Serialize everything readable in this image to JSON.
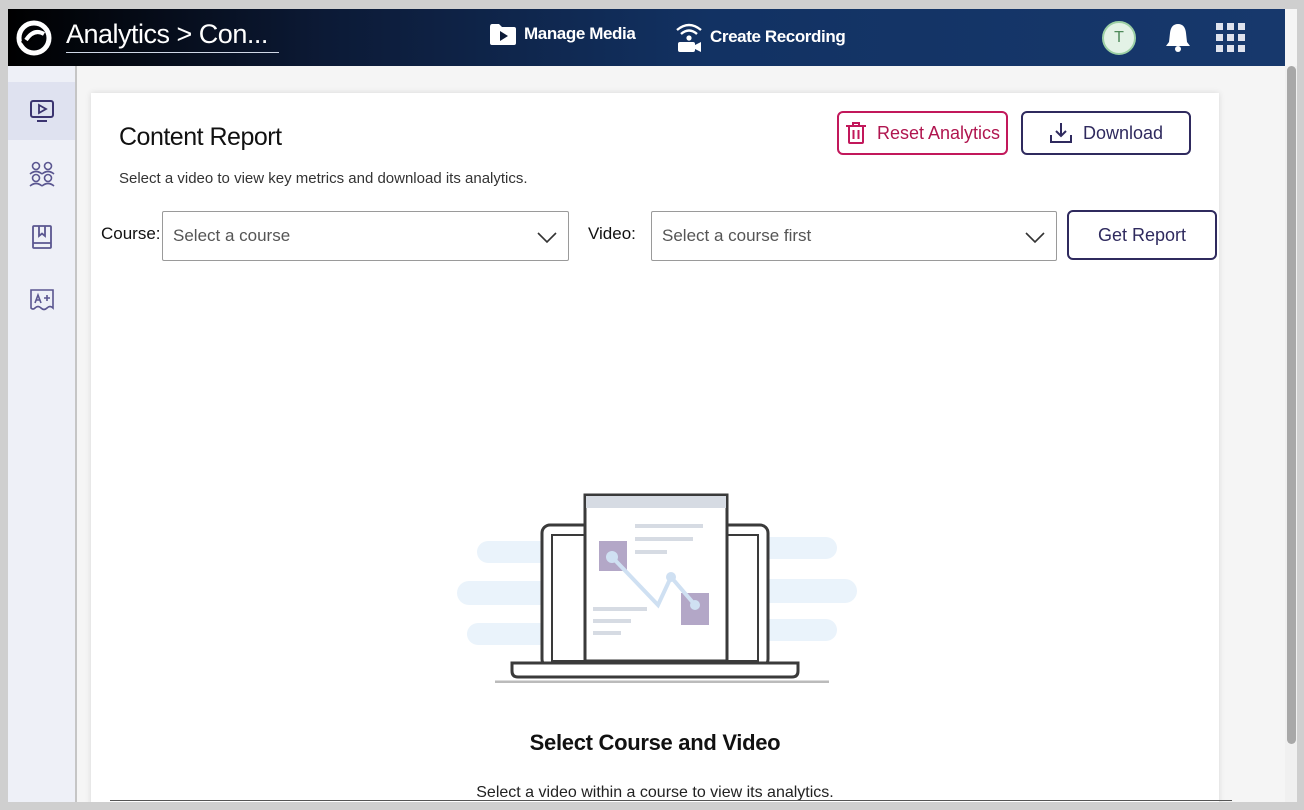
{
  "topbar": {
    "breadcrumb": "Analytics > Con...",
    "manage_media": "Manage Media",
    "create_recording": "Create Recording",
    "avatar_initial": "T"
  },
  "sidebar": {
    "items": [
      {
        "icon": "video-icon",
        "active": true
      },
      {
        "icon": "users-icon",
        "active": false
      },
      {
        "icon": "book-icon",
        "active": false
      },
      {
        "icon": "grade-icon",
        "active": false
      }
    ]
  },
  "report": {
    "title": "Content Report",
    "subtitle": "Select a video to view key metrics and download its analytics.",
    "reset_label": "Reset Analytics",
    "download_label": "Download",
    "course_label": "Course:",
    "course_placeholder": "Select a course",
    "video_label": "Video:",
    "video_placeholder": "Select a course first",
    "get_report_label": "Get Report"
  },
  "empty_state": {
    "title": "Select Course and Video",
    "subtitle": "Select a video within a course to view its analytics."
  },
  "colors": {
    "reset": "#c2185b",
    "primary": "#2f2a5e",
    "topbar": "#17386c"
  }
}
